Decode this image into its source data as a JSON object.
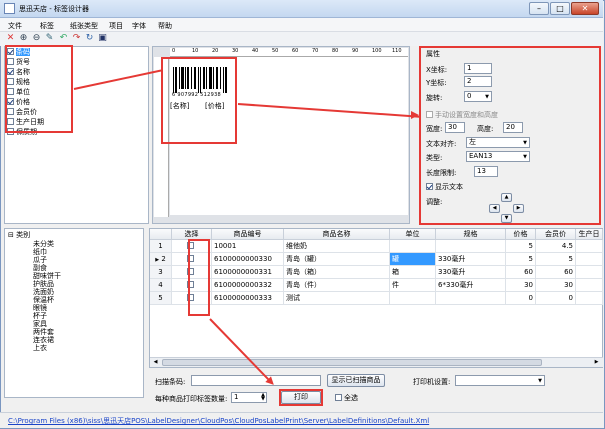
{
  "window": {
    "title": "思迅天店 - 标签设计器"
  },
  "menu": [
    "文件",
    "标签",
    "纸张类型",
    "项目",
    "字体",
    "帮助"
  ],
  "toolbar_icons": [
    "delete-icon",
    "zoom-in-icon",
    "zoom-out-icon",
    "pen-icon",
    "undo-icon",
    "redo-icon",
    "refresh-icon",
    "save-icon"
  ],
  "field_list": [
    {
      "label": "条码",
      "checked": true,
      "selected": true
    },
    {
      "label": "货号",
      "checked": false
    },
    {
      "label": "名称",
      "checked": true
    },
    {
      "label": "规格",
      "checked": false
    },
    {
      "label": "单位",
      "checked": false
    },
    {
      "label": "价格",
      "checked": true
    },
    {
      "label": "会员价",
      "checked": false
    },
    {
      "label": "生产日期",
      "checked": false
    },
    {
      "label": "保质期",
      "checked": false
    }
  ],
  "canvas": {
    "ruler_marks": [
      "0",
      "10",
      "20",
      "30",
      "40",
      "50",
      "60",
      "70",
      "80",
      "90",
      "100",
      "110"
    ],
    "barcode_text": "6 907992 512938",
    "label_left": "[名称]",
    "label_right": "[价格]"
  },
  "props": {
    "title": "属性",
    "x_label": "X坐标:",
    "x_value": "1",
    "y_label": "Y坐标:",
    "y_value": "2",
    "rotate_label": "旋转:",
    "rotate_value": "0",
    "manual_size_label": "手动设置宽度和高度",
    "width_label": "宽度:",
    "width_value": "30",
    "height_label": "高度:",
    "height_value": "20",
    "align_label": "文本对齐:",
    "align_value": "左",
    "type_label": "类型:",
    "type_value": "EAN13",
    "length_label": "长度限制:",
    "length_value": "13",
    "show_text_label": "显示文本",
    "adjust_label": "调整:"
  },
  "tree": {
    "root": "类别",
    "items": [
      "未分类",
      "纸巾",
      "瓜子",
      "副食",
      "甜味饼干",
      "护肤品",
      "洗面奶",
      "保温杯",
      "眼镜",
      "杯子",
      "家具",
      "两件套",
      "连衣裙",
      "上衣"
    ]
  },
  "grid": {
    "headers": [
      "",
      "选择",
      "商品编号",
      "商品名称",
      "单位",
      "规格",
      "价格",
      "会员价",
      "生产日"
    ],
    "rows": [
      {
        "num": "1",
        "code": "10001",
        "name": "维他奶",
        "unit": "",
        "spec": "",
        "price": "5",
        "member": "4.5",
        "current": false
      },
      {
        "num": "2",
        "code": "6100000000330",
        "name": "青岛（罐）",
        "unit": "罐",
        "spec": "330毫升",
        "price": "5",
        "member": "5",
        "current": true
      },
      {
        "num": "3",
        "code": "6100000000331",
        "name": "青岛（箱）",
        "unit": "箱",
        "spec": "330毫升",
        "price": "60",
        "member": "60",
        "current": false
      },
      {
        "num": "4",
        "code": "6100000000332",
        "name": "青岛（件）",
        "unit": "件",
        "spec": "6*330毫升",
        "price": "30",
        "member": "30",
        "current": false
      },
      {
        "num": "5",
        "code": "6100000000333",
        "name": "测试",
        "unit": "",
        "spec": "",
        "price": "0",
        "member": "0",
        "current": false
      }
    ]
  },
  "bottom": {
    "scan_label": "扫描条码:",
    "show_scanned_button": "显示已扫描商品",
    "printer_label": "打印机设置:",
    "copies_label": "每种商品打印标签数量:",
    "copies_value": "1",
    "print_button": "打印",
    "select_all_label": "全选"
  },
  "status_path": "C:\\Program Files (x86)\\siss\\思迅天店POS\\LabelDesigner\\CloudPos\\CloudPosLabelPrint\\Server\\LabelDefinitions\\Default.Xml",
  "colors": {
    "highlight": "#e53935",
    "selection": "#3399ff",
    "titlebar": "#c4d8f0"
  }
}
